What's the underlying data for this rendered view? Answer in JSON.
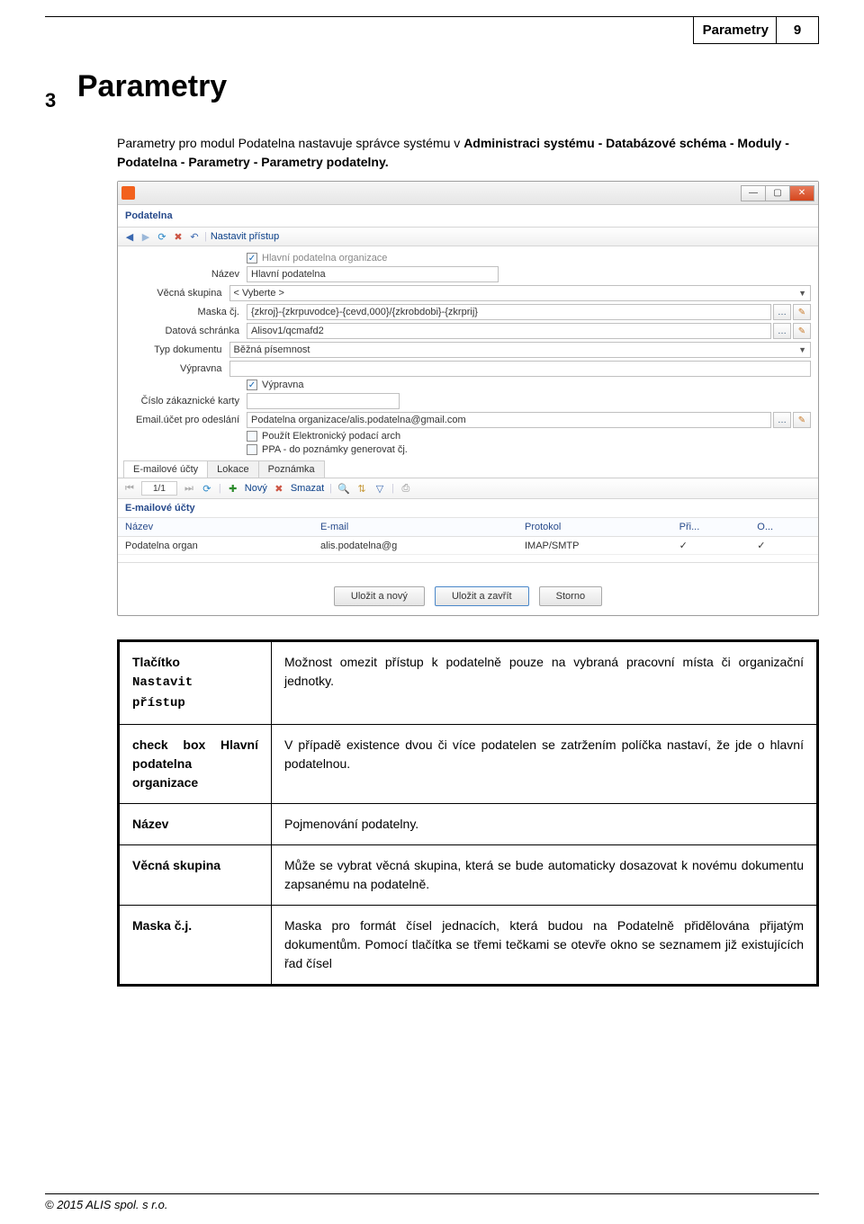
{
  "page_header": {
    "title": "Parametry",
    "num": "9"
  },
  "chapter": {
    "num": "3",
    "title": "Parametry"
  },
  "intro": {
    "text_prefix": "Parametry pro modul Podatelna nastavuje správce systému v ",
    "bold": "Administraci systému - Databázové schéma - Moduly - Podatelna - Parametry - Parametry podatelny.",
    "text_suffix": ""
  },
  "win": {
    "section_title": "Podatelna",
    "toolbar_access": "Nastavit přístup",
    "cb_main": "Hlavní podatelna organizace",
    "lbl_nazev": "Název",
    "val_nazev": "Hlavní podatelna",
    "lbl_vecna": "Věcná skupina",
    "val_vecna": "< Vyberte >",
    "lbl_maska": "Maska čj.",
    "val_maska": "{zkroj}-{zkrpuvodce}-{cevd,000}/{zkrobdobi}-{zkrprij}",
    "lbl_ds": "Datová schránka",
    "val_ds": "Alisov1/qcmafd2",
    "lbl_typ": "Typ dokumentu",
    "val_typ": "Běžná písemnost",
    "lbl_vyp": "Výpravna",
    "cb_vyp": "Výpravna",
    "lbl_cislo": "Číslo zákaznické karty",
    "lbl_email": "Email.účet pro odeslání",
    "val_email": "Podatelna organizace/alis.podatelna@gmail.com",
    "cb_arch": "Použít Elektronický podací arch",
    "cb_ppa": "PPA - do poznámky generovat čj.",
    "tabs": [
      "E-mailové účty",
      "Lokace",
      "Poznámka"
    ],
    "counter": "1/1",
    "sub_novy": "Nový",
    "sub_smazat": "Smazat",
    "subhead": "E-mailové účty",
    "cols": {
      "nazev": "Název",
      "email": "E-mail",
      "protokol": "Protokol",
      "pri": "Při...",
      "o": "O..."
    },
    "row": {
      "nazev": "Podatelna organ",
      "email": "alis.podatelna@g",
      "protokol": "IMAP/SMTP",
      "pri": "✓",
      "o": "✓"
    },
    "btn_savenew": "Uložit a nový",
    "btn_saveclose": "Uložit a zavřít",
    "btn_storno": "Storno"
  },
  "desc": {
    "r1_left_line1": "Tlačítko",
    "r1_left_line2": "Nastavit",
    "r1_left_line3": "přístup",
    "r1_right": "Možnost omezit přístup k podatelně pouze na vybraná pracovní místa či organizační jednotky.",
    "r2_left": "check box Hlavní podatelna organizace",
    "r2_right": "V případě existence dvou či více podatelen se zatržením políčka nastaví, že jde o hlavní podatelnou.",
    "r3_left": "Název",
    "r3_right": "Pojmenování podatelny.",
    "r4_left": "Věcná skupina",
    "r4_right": "Může se vybrat věcná skupina, která se bude automaticky dosazovat k novému dokumentu zapsanému na podatelně.",
    "r5_left": "Maska č.j.",
    "r5_right": "Maska pro formát čísel jednacích, která budou na Podatelně přidělována přijatým dokumentům. Pomocí tlačítka se třemi tečkami se otevře okno se seznamem již existujících řad čísel"
  },
  "footer": "© 2015 ALIS spol. s r.o."
}
